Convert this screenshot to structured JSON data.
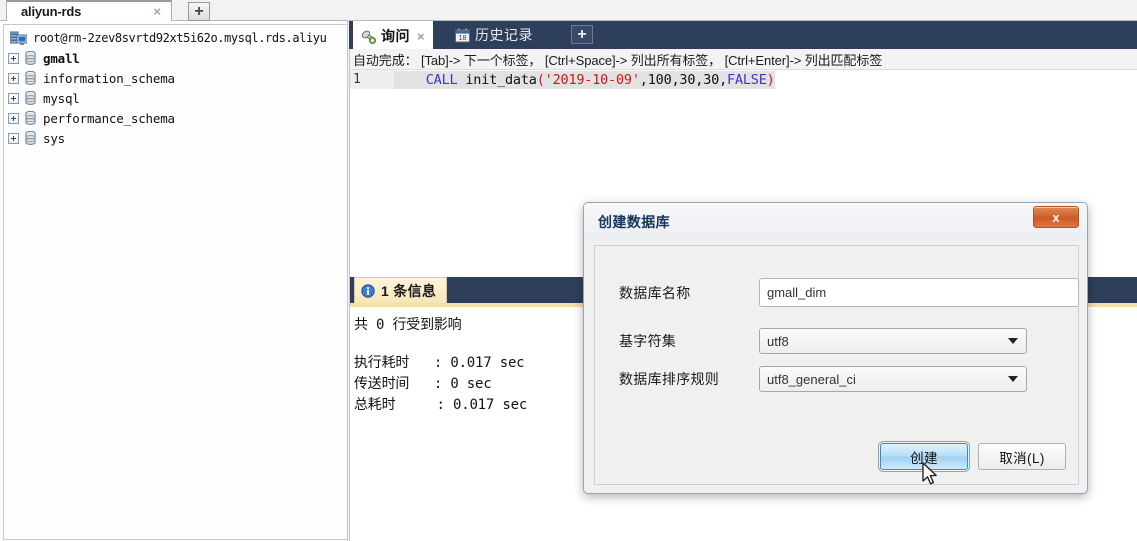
{
  "window": {
    "connection_tab": {
      "label": "aliyun-rds",
      "close_glyph": "×",
      "add_glyph": "+"
    }
  },
  "sidebar": {
    "root": {
      "icon": "server-icon",
      "label": "root@rm-2zev8svrtd92xt5i62o.mysql.rds.aliyu"
    },
    "items": [
      {
        "label": "gmall",
        "icon": "database-icon",
        "bold": true
      },
      {
        "label": "information_schema",
        "icon": "database-icon",
        "bold": false
      },
      {
        "label": "mysql",
        "icon": "database-icon",
        "bold": false
      },
      {
        "label": "performance_schema",
        "icon": "database-icon",
        "bold": false
      },
      {
        "label": "sys",
        "icon": "database-icon",
        "bold": false
      }
    ]
  },
  "query_area": {
    "tabs": [
      {
        "label": "询问",
        "icon": "query-icon",
        "active": true,
        "close_glyph": "×"
      },
      {
        "label": "历史记录",
        "icon": "calendar-icon",
        "active": false
      }
    ],
    "add_tab_glyph": "+",
    "hint": "自动完成： [Tab]-> 下一个标签， [Ctrl+Space]-> 列出所有标签， [Ctrl+Enter]-> 列出匹配标签",
    "code": {
      "line_number": "1",
      "indent": "    ",
      "keyword": "CALL",
      "function_name": " init_data",
      "open_paren": "(",
      "string_arg": "'2019-10-09'",
      "args": ",100,30,30,",
      "bool_arg": "FALSE",
      "close_paren": ")"
    }
  },
  "messages": {
    "tab_label": "1 条信息",
    "tab_icon": "info-icon",
    "lines": [
      "共 0 行受到影响",
      "执行耗时   : 0.017 sec",
      "传送时间   : 0 sec",
      "总耗时     : 0.017 sec"
    ]
  },
  "dialog": {
    "title": "创建数据库",
    "close_label": "x",
    "fields": [
      {
        "label": "数据库名称",
        "type": "text",
        "value": "gmall_dim",
        "placeholder": ""
      },
      {
        "label": "基字符集",
        "type": "select",
        "value": "utf8"
      },
      {
        "label": "数据库排序规则",
        "type": "select",
        "value": "utf8_general_ci"
      }
    ],
    "buttons": [
      {
        "label": "创建",
        "kind": "primary",
        "name": "create-button"
      },
      {
        "label": "取消(L)",
        "kind": "normal",
        "name": "cancel-button"
      }
    ]
  },
  "colors": {
    "panel_header": "#2e3f5c",
    "message_tab": "#f6e6b8",
    "accent_blue": "#3a36d0",
    "string_red": "#d01414",
    "dialog_title": "#17365d"
  }
}
